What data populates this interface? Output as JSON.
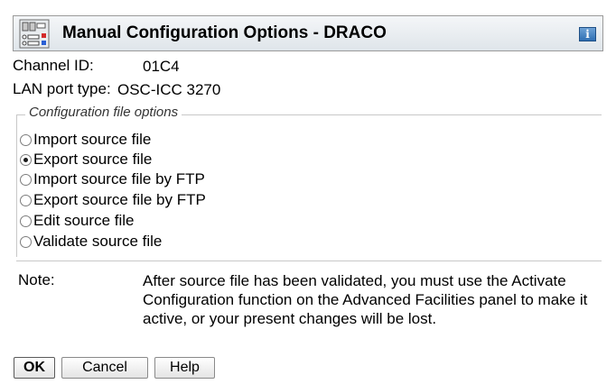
{
  "window": {
    "title": "Manual Configuration Options - DRACO",
    "app_icon": "network-adapter-icon",
    "help_icon": "info-icon",
    "help_glyph": "i"
  },
  "fields": {
    "channel_id_label": "Channel ID:",
    "channel_id_value": "01C4",
    "lan_port_label": "LAN port type:",
    "lan_port_value": "OSC-ICC 3270"
  },
  "config_options": {
    "legend": "Configuration file options",
    "selected_index": 1,
    "options": [
      {
        "label": "Import source file",
        "checked": false
      },
      {
        "label": "Export source file",
        "checked": true
      },
      {
        "label": "Import source file by FTP",
        "checked": false
      },
      {
        "label": "Export source file by FTP",
        "checked": false
      },
      {
        "label": "Edit source file",
        "checked": false
      },
      {
        "label": "Validate source file",
        "checked": false
      }
    ]
  },
  "note": {
    "label": "Note:",
    "text": "After source file has been validated, you must use the Activate Configuration function on the Advanced Facilities panel to make it active, or your present changes will be lost."
  },
  "buttons": {
    "ok": "OK",
    "cancel": "Cancel",
    "help": "Help"
  }
}
